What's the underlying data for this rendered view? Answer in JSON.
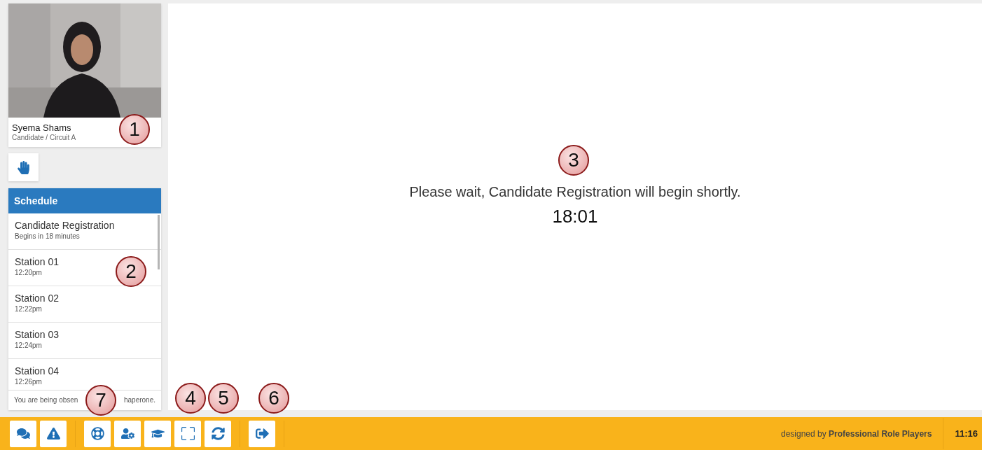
{
  "participant": {
    "name": "Syema Shams",
    "role": "Candidate / Circuit A"
  },
  "schedule": {
    "title": "Schedule",
    "items": [
      {
        "title": "Candidate Registration",
        "time": "Begins in 18 minutes"
      },
      {
        "title": "Station 01",
        "time": "12:20pm"
      },
      {
        "title": "Station 02",
        "time": "12:22pm"
      },
      {
        "title": "Station 03",
        "time": "12:24pm"
      },
      {
        "title": "Station 04",
        "time": "12:26pm"
      }
    ],
    "note": [
      "You are being obsen",
      "haperone."
    ]
  },
  "main": {
    "message": "Please wait, Candidate Registration will begin shortly.",
    "countdown": "18:01"
  },
  "toolbar": {
    "groups": [
      [
        {
          "kind": "chat"
        },
        {
          "kind": "alert"
        }
      ],
      [
        {
          "kind": "help"
        },
        {
          "kind": "user-settings"
        },
        {
          "kind": "training"
        },
        {
          "kind": "fullscreen"
        },
        {
          "kind": "refresh"
        }
      ],
      [
        {
          "kind": "exit"
        }
      ]
    ],
    "credit_prefix": "designed by",
    "credit_name": "Professional Role Players",
    "clock": "11:16"
  },
  "callouts": [
    {
      "label": "1"
    },
    {
      "label": "3"
    },
    {
      "label": "2"
    },
    {
      "label": "7"
    },
    {
      "label": "4"
    },
    {
      "label": "5"
    },
    {
      "label": "6"
    }
  ]
}
